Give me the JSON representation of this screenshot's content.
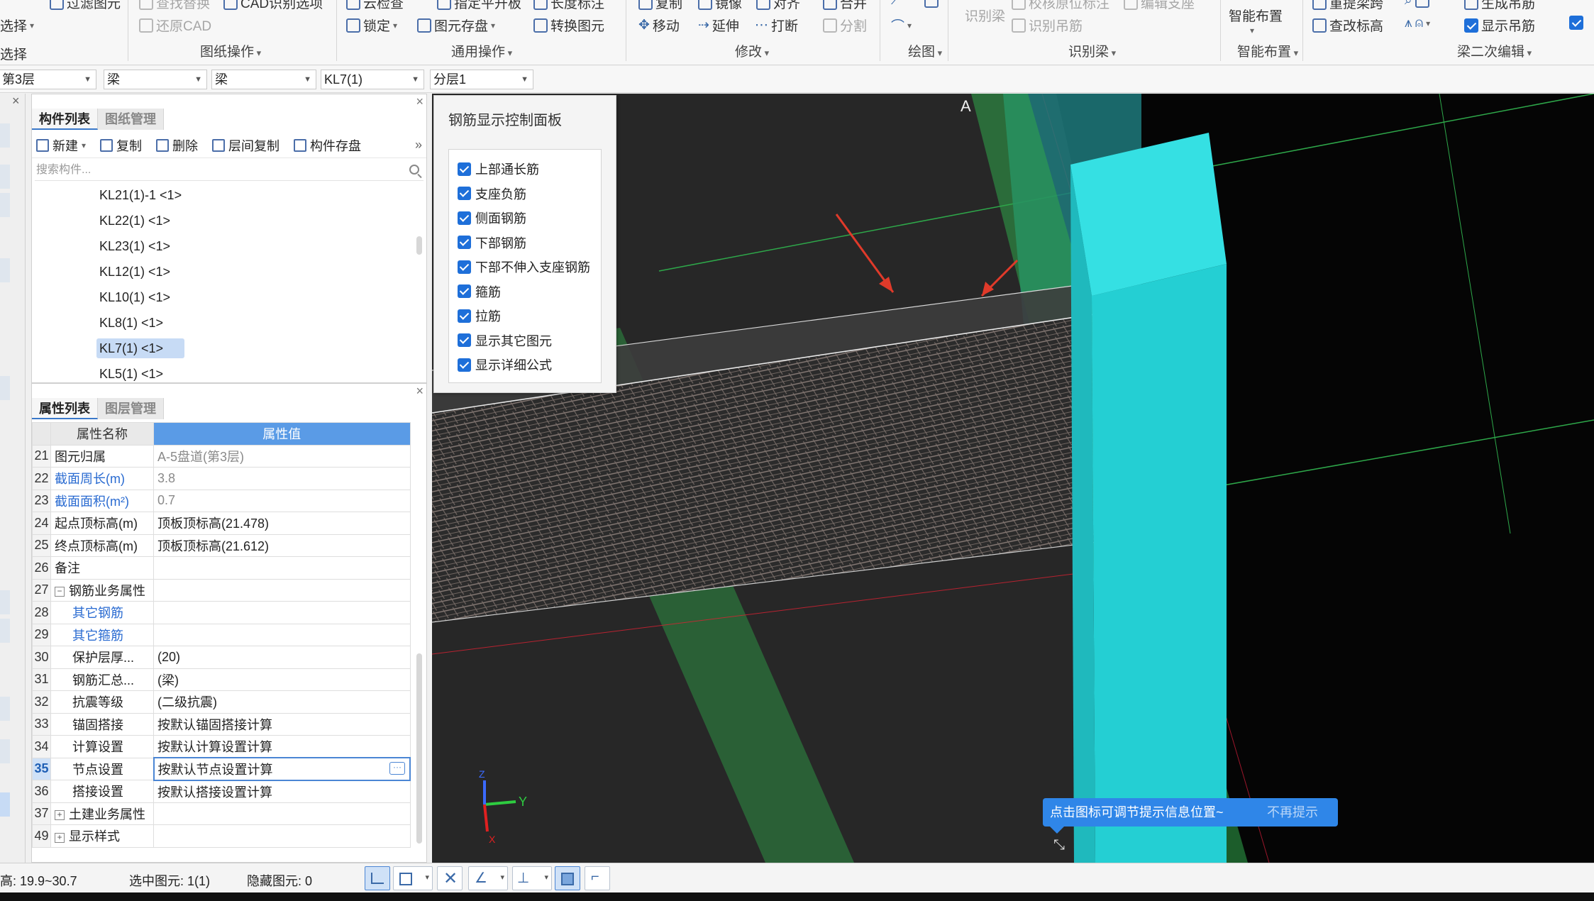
{
  "ribbon": {
    "items": {
      "filter_elements": "过滤图元",
      "select": "选择",
      "select_label": "选择",
      "find_replace": "查找替换",
      "cad_options": "CAD识别选项",
      "restore_cad": "还原CAD",
      "drawing_ops_group": "图纸操作",
      "cloud_check": "云检查",
      "lock": "锁定",
      "specify_plane": "指定平升板",
      "element_store": "图元存盘",
      "convert_element": "转换图元",
      "length_mark": "长度标注",
      "general_ops_group": "通用操作",
      "copy": "复制",
      "mirror": "镜像",
      "align": "对齐",
      "merge": "合并",
      "move": "移动",
      "extend": "延伸",
      "break": "打断",
      "split": "分割",
      "modify_group": "修改",
      "draw_group": "绘图",
      "identify_beam": "识别梁",
      "verify_origin": "校核原位标注",
      "edit_support": "编辑支座",
      "identify_hanger": "识别吊筋",
      "identify_group": "识别梁",
      "smart_layout": "智能布置",
      "smart_layout_group": "智能布置",
      "redefine_span": "重提梁跨",
      "check_elevation": "查改标高",
      "generate_hanger": "生成吊筋",
      "show_hanger": "显示吊筋",
      "beam_secondary_group": "梁二次编辑"
    }
  },
  "selectors": {
    "floor": "第3层",
    "category": "梁",
    "type": "梁",
    "component": "KL7(1)",
    "layer": "分层1"
  },
  "component_panel": {
    "tabs": [
      "构件列表",
      "图纸管理"
    ],
    "toolbar": {
      "new": "新建",
      "copy": "复制",
      "delete": "删除",
      "floor_copy": "层间复制",
      "save_component": "构件存盘"
    },
    "search_placeholder": "搜索构件...",
    "items": [
      "KL21(1)-1 <1>",
      "KL22(1) <1>",
      "KL23(1) <1>",
      "KL12(1) <1>",
      "KL10(1) <1>",
      "KL8(1) <1>",
      "KL7(1) <1>",
      "KL5(1) <1>"
    ],
    "selected_index": 6
  },
  "property_panel": {
    "tabs": [
      "属性列表",
      "图层管理"
    ],
    "header": {
      "name": "属性名称",
      "value": "属性值"
    },
    "rows": [
      {
        "num": "21",
        "name": "图元归属",
        "value": "A-5盘道(第3层)"
      },
      {
        "num": "22",
        "name": "截面周长(m)",
        "value": "3.8"
      },
      {
        "num": "23",
        "name": "截面面积(m²)",
        "value": "0.7"
      },
      {
        "num": "24",
        "name": "起点顶标高(m)",
        "value": "顶板顶标高(21.478)"
      },
      {
        "num": "25",
        "name": "终点顶标高(m)",
        "value": "顶板顶标高(21.612)"
      },
      {
        "num": "26",
        "name": "备注",
        "value": ""
      },
      {
        "num": "27",
        "name": "钢筋业务属性",
        "value": ""
      },
      {
        "num": "28",
        "name": "其它钢筋",
        "value": ""
      },
      {
        "num": "29",
        "name": "其它箍筋",
        "value": ""
      },
      {
        "num": "30",
        "name": "保护层厚...",
        "value": "(20)"
      },
      {
        "num": "31",
        "name": "钢筋汇总...",
        "value": "(梁)"
      },
      {
        "num": "32",
        "name": "抗震等级",
        "value": "(二级抗震)"
      },
      {
        "num": "33",
        "name": "锚固搭接",
        "value": "按默认锚固搭接计算"
      },
      {
        "num": "34",
        "name": "计算设置",
        "value": "按默认计算设置计算"
      },
      {
        "num": "35",
        "name": "节点设置",
        "value": "按默认节点设置计算"
      },
      {
        "num": "36",
        "name": "搭接设置",
        "value": "按默认搭接设置计算"
      },
      {
        "num": "37",
        "name": "土建业务属性",
        "value": ""
      },
      {
        "num": "49",
        "name": "显示样式",
        "value": ""
      }
    ],
    "active_row": "35"
  },
  "rebar_panel": {
    "title": "钢筋显示控制面板",
    "options": [
      "上部通长筋",
      "支座负筋",
      "侧面钢筋",
      "下部钢筋",
      "下部不伸入支座钢筋",
      "箍筋",
      "拉筋",
      "显示其它图元",
      "显示详细公式"
    ]
  },
  "viewport": {
    "axis_label": "A",
    "axis_y": "Y",
    "axis_z": "Z",
    "axis_x": "X",
    "tip_text": "点击图标可调节提示信息位置~",
    "tip_dismiss": "不再提示"
  },
  "statusbar": {
    "elevation": "高: 19.9~30.7",
    "selected": "选中图元: 1(1)",
    "hidden": "隐藏图元: 0"
  },
  "colors": {
    "accent": "#1e6fd9",
    "cyan_column": "#2fd4d8",
    "teal_wall": "#1f8a8e",
    "green_beam": "#3fbf52",
    "arrow_red": "#e03a2a"
  }
}
